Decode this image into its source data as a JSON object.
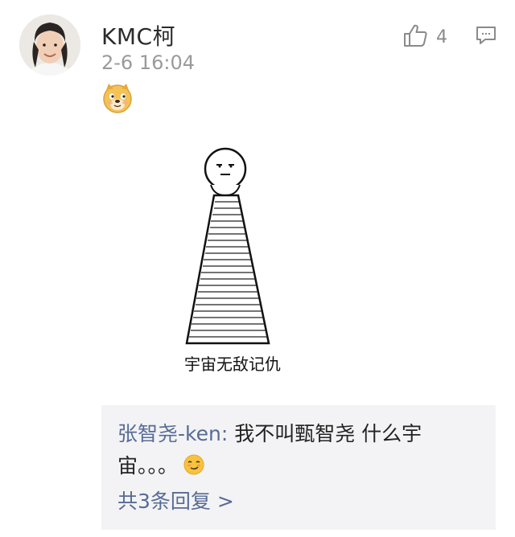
{
  "comment": {
    "username": "KMC柯",
    "timestamp": "2-6 16:04",
    "like_count": "4",
    "icons": {
      "like": "thumbs-up-icon",
      "reply": "comment-bubble-icon",
      "emoji": "doge-emoji-icon"
    }
  },
  "meme": {
    "caption": "宇宙无敌记仇"
  },
  "reply": {
    "author": "张智尧-ken",
    "separator": ": ",
    "text": "我不叫甄智尧 什么宇宙。。。",
    "emoji": "smirk-emoji-icon",
    "view_more": "共3条回复 >"
  },
  "colors": {
    "link": "#576b95",
    "reply_bg": "#f3f3f5",
    "meta": "#9a9a9a"
  }
}
